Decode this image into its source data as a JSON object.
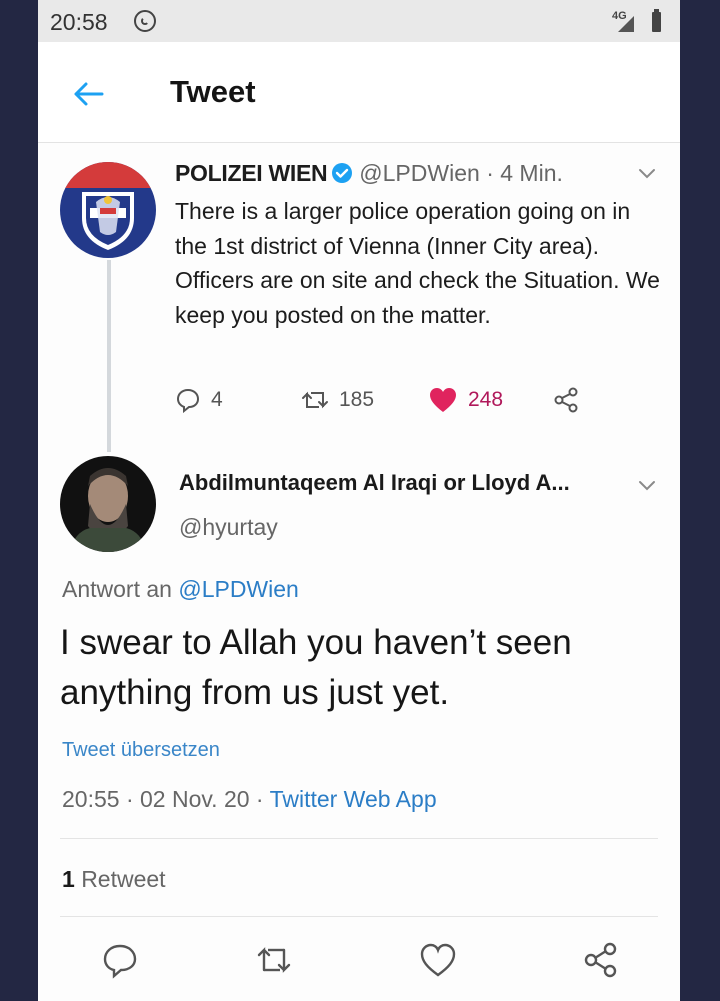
{
  "status_bar": {
    "time": "20:58",
    "network": "4G"
  },
  "header": {
    "title": "Tweet"
  },
  "tweet1": {
    "name": "POLIZEI WIEN",
    "handle": "@LPDWien",
    "separator": "·",
    "time": "4 Min.",
    "text": "There is a larger police operation going on in the 1st district of Vienna (Inner City area). Officers are on site and check the Situation. We keep you posted on the matter.",
    "replies": "4",
    "retweets": "185",
    "likes": "248",
    "like_color": "#e0245e"
  },
  "tweet2": {
    "name": "Abdilmuntaqeem Al Iraqi or Lloyd A...",
    "handle": "@hyurtay",
    "reply_prefix": "Antwort an",
    "reply_to": "@LPDWien",
    "text": "I swear to Allah you haven’t seen anything from us just yet.",
    "translate": "Tweet übersetzen",
    "timestamp": "20:55 · 02 Nov. 20 · ",
    "source": "Twitter Web App",
    "retweet_count": "1",
    "retweet_label": "Retweet"
  },
  "colors": {
    "link": "#2b7dc6",
    "police_red": "#d23a3a",
    "police_blue": "#233a8c"
  }
}
